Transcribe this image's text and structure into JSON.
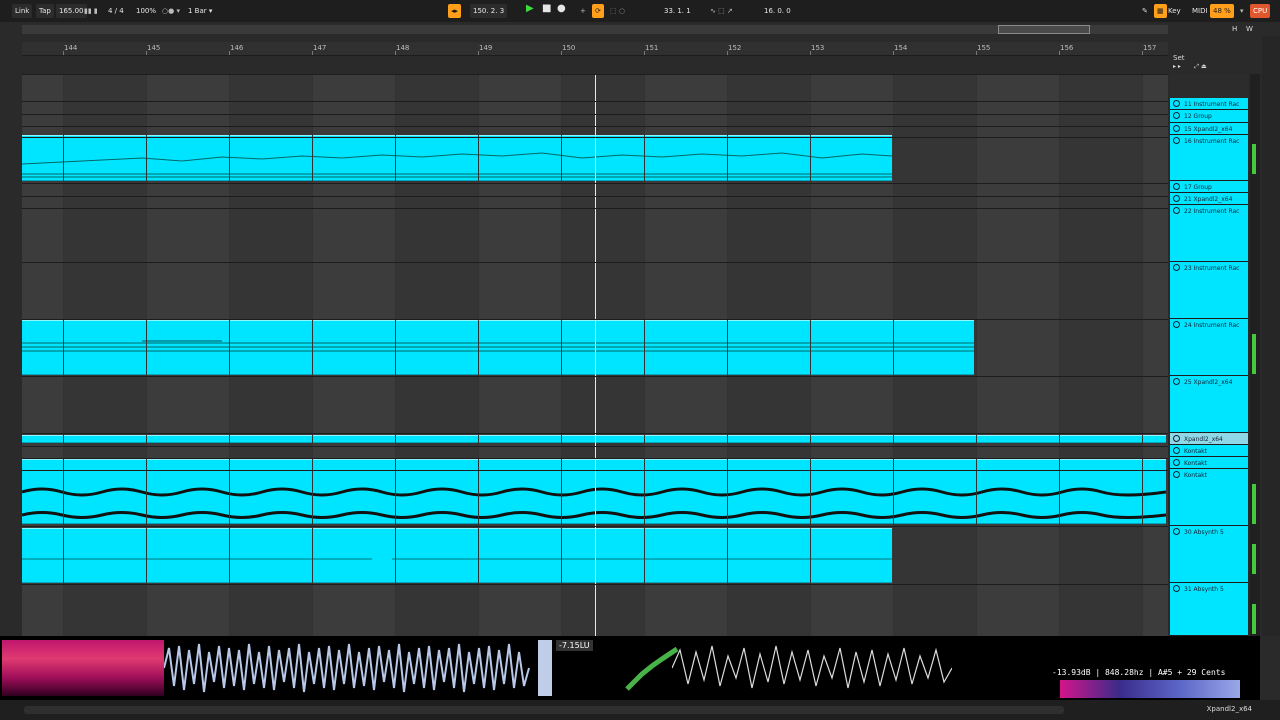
{
  "transport": {
    "link": "Link",
    "tap": "Tap",
    "tempo": "165.00",
    "signature": "4 / 4",
    "zoom": "100%",
    "quantize": "1 Bar",
    "position": "150.  2.  3",
    "loop_start": "33.  1.  1",
    "loop_length": "16.  0.  0",
    "key": "Key",
    "midi": "MIDI",
    "cpu": "CPU",
    "cpu_percent": "48 %"
  },
  "overview": {
    "h": "H",
    "w": "W"
  },
  "ruler": {
    "bars": [
      "144",
      "145",
      "146",
      "147",
      "148",
      "149",
      "150",
      "151",
      "152",
      "153",
      "154",
      "155",
      "156",
      "157"
    ]
  },
  "set_label": "Set",
  "tracks": [
    {
      "name": "11 Instrument Rac"
    },
    {
      "name": "12 Group"
    },
    {
      "name": "15 Xpandl2_x64"
    },
    {
      "name": "16 Instrument Rac"
    },
    {
      "name": "17 Group"
    },
    {
      "name": "21 Xpandl2_x64"
    },
    {
      "name": "22 Instrument Rac"
    },
    {
      "name": "23 Instrument Rac"
    },
    {
      "name": "24 Instrument Rac"
    },
    {
      "name": "25 Xpandl2_x64"
    },
    {
      "name": "Xpandl2_x64"
    },
    {
      "name": "Kontakt"
    },
    {
      "name": "Kontakt"
    },
    {
      "name": "Kontakt"
    },
    {
      "name": "30 Absynth 5"
    },
    {
      "name": "31 Absynth 5"
    }
  ],
  "visualizer": {
    "loudness": "-7.15LU",
    "readout": "-13.93dB | 848.28hz | A#5 + 29 Cents"
  },
  "status_track": "Xpandl2_x64",
  "colors": {
    "clip": "#00e5ff",
    "accent": "#ff9f1a",
    "cpu": "#e0572d"
  }
}
